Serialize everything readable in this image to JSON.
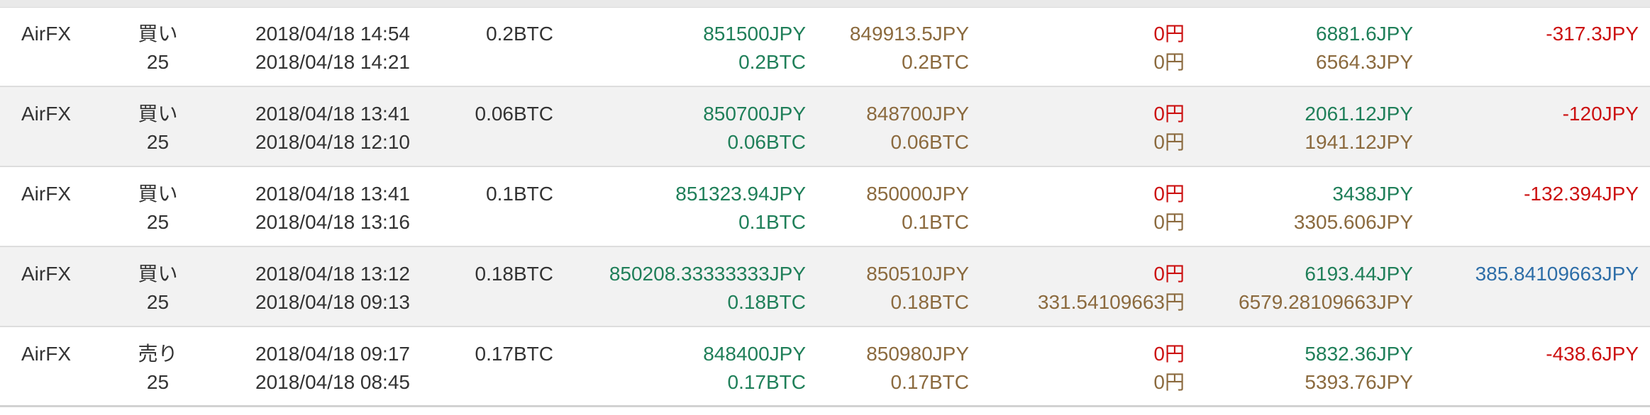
{
  "colors": {
    "buy_green": "#1f7f59",
    "sell_brown": "#8b6a3e",
    "loss_red": "#cc1111",
    "profit_blue": "#2e6ea8",
    "text": "#333333",
    "alt_row_bg": "#f2f2f2"
  },
  "trades": [
    {
      "exchange": "AirFX",
      "side": "買い",
      "leverage": "25",
      "datetime_close": "2018/04/18 14:54",
      "datetime_open": "2018/04/18 14:21",
      "amount": "0.2BTC",
      "entry_price": "851500JPY",
      "entry_size": "0.2BTC",
      "exit_price": "849913.5JPY",
      "exit_size": "0.2BTC",
      "fee_1": "0円",
      "fee_2": "0円",
      "value_1": "6881.6JPY",
      "value_2": "6564.3JPY",
      "pnl": "-317.3JPY",
      "pnl_color": "red"
    },
    {
      "exchange": "AirFX",
      "side": "買い",
      "leverage": "25",
      "datetime_close": "2018/04/18 13:41",
      "datetime_open": "2018/04/18 12:10",
      "amount": "0.06BTC",
      "entry_price": "850700JPY",
      "entry_size": "0.06BTC",
      "exit_price": "848700JPY",
      "exit_size": "0.06BTC",
      "fee_1": "0円",
      "fee_2": "0円",
      "value_1": "2061.12JPY",
      "value_2": "1941.12JPY",
      "pnl": "-120JPY",
      "pnl_color": "red"
    },
    {
      "exchange": "AirFX",
      "side": "買い",
      "leverage": "25",
      "datetime_close": "2018/04/18 13:41",
      "datetime_open": "2018/04/18 13:16",
      "amount": "0.1BTC",
      "entry_price": "851323.94JPY",
      "entry_size": "0.1BTC",
      "exit_price": "850000JPY",
      "exit_size": "0.1BTC",
      "fee_1": "0円",
      "fee_2": "0円",
      "value_1": "3438JPY",
      "value_2": "3305.606JPY",
      "pnl": "-132.394JPY",
      "pnl_color": "red"
    },
    {
      "exchange": "AirFX",
      "side": "買い",
      "leverage": "25",
      "datetime_close": "2018/04/18 13:12",
      "datetime_open": "2018/04/18 09:13",
      "amount": "0.18BTC",
      "entry_price": "850208.33333333JPY",
      "entry_size": "0.18BTC",
      "exit_price": "850510JPY",
      "exit_size": "0.18BTC",
      "fee_1": "0円",
      "fee_2": "331.54109663円",
      "value_1": "6193.44JPY",
      "value_2": "6579.28109663JPY",
      "pnl": "385.84109663JPY",
      "pnl_color": "blue"
    },
    {
      "exchange": "AirFX",
      "side": "売り",
      "leverage": "25",
      "datetime_close": "2018/04/18 09:17",
      "datetime_open": "2018/04/18 08:45",
      "amount": "0.17BTC",
      "entry_price": "848400JPY",
      "entry_size": "0.17BTC",
      "exit_price": "850980JPY",
      "exit_size": "0.17BTC",
      "fee_1": "0円",
      "fee_2": "0円",
      "value_1": "5832.36JPY",
      "value_2": "5393.76JPY",
      "pnl": "-438.6JPY",
      "pnl_color": "red"
    }
  ]
}
